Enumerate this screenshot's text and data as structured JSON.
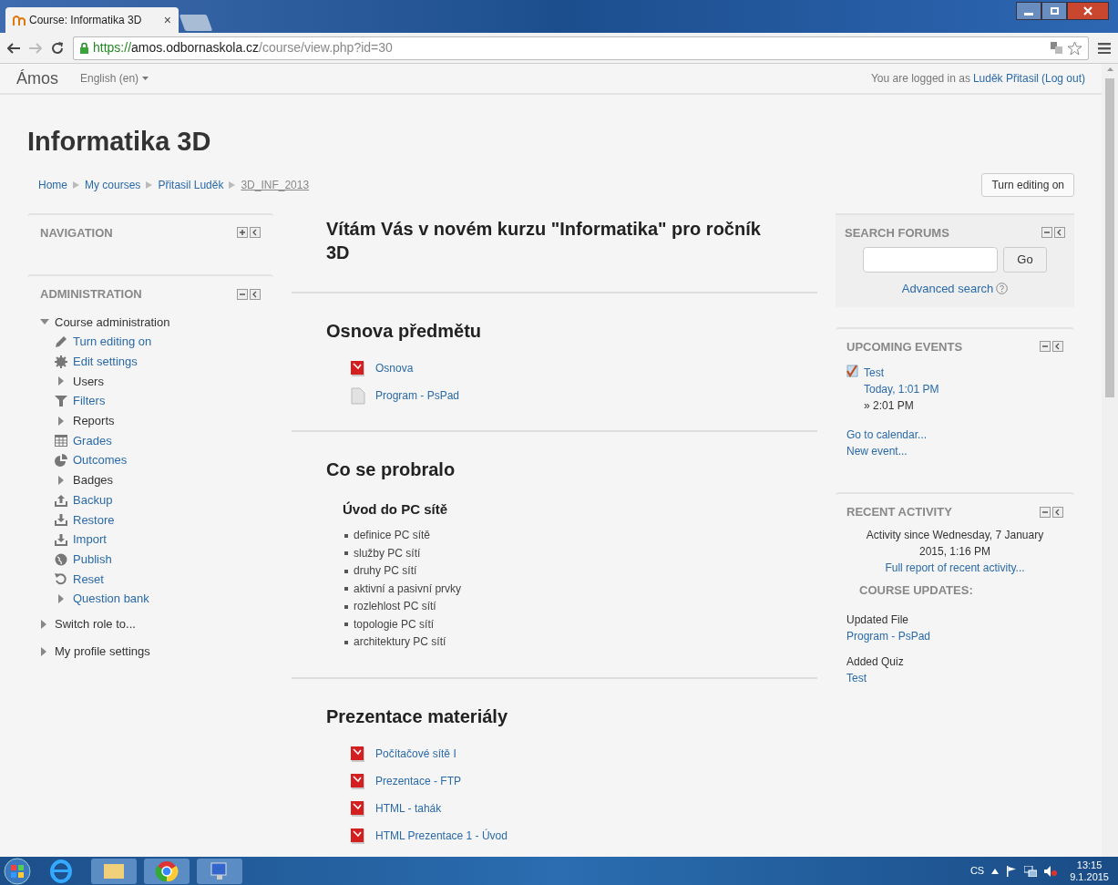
{
  "browser": {
    "tab_title": "Course: Informatika 3D",
    "tab_close": "×",
    "url_scheme": "https://",
    "url_host": "amos.odbornaskola.cz",
    "url_path": "/course/view.php?id=30"
  },
  "navbar": {
    "brand": "Ámos",
    "language": "English (en)",
    "login_prefix": "You are logged in as ",
    "user": "Luděk Přitasil",
    "logout": "(Log out)"
  },
  "page_title": "Informatika 3D",
  "breadcrumb": [
    "Home",
    "My courses",
    "Přitasil Luděk",
    "3D_INF_2013"
  ],
  "edit_button": "Turn editing on",
  "navigation_block": {
    "title": "NAVIGATION"
  },
  "administration": {
    "title": "ADMINISTRATION",
    "root": {
      "label": "Course administration",
      "expanded": true,
      "children": [
        {
          "label": "Turn editing on",
          "kind": "edit"
        },
        {
          "label": "Edit settings",
          "kind": "settings"
        },
        {
          "label": "Users",
          "kind": "branch"
        },
        {
          "label": "Filters",
          "kind": "filter"
        },
        {
          "label": "Reports",
          "kind": "branch"
        },
        {
          "label": "Grades",
          "kind": "grades"
        },
        {
          "label": "Outcomes",
          "kind": "outcomes"
        },
        {
          "label": "Badges",
          "kind": "branch"
        },
        {
          "label": "Backup",
          "kind": "backup"
        },
        {
          "label": "Restore",
          "kind": "restore"
        },
        {
          "label": "Import",
          "kind": "restore"
        },
        {
          "label": "Publish",
          "kind": "publish"
        },
        {
          "label": "Reset",
          "kind": "reset"
        },
        {
          "label": "Question bank",
          "kind": "branchlink"
        }
      ]
    },
    "others": [
      {
        "label": "Switch role to...",
        "expanded": false
      },
      {
        "label": "My profile settings",
        "expanded": false
      }
    ]
  },
  "welcome": "Vítám Vás v novém kurzu \"Informatika\" pro ročník 3D",
  "sections": [
    {
      "title": "Osnova předmětu",
      "resources": [
        {
          "label": "Osnova",
          "kind": "pdf"
        },
        {
          "label": "Program - PsPad",
          "kind": "file"
        }
      ]
    },
    {
      "title": "Co se probralo",
      "subtitle": "Úvod do PC sítě",
      "bullets": [
        "definice PC sítě",
        "služby PC sítí",
        "druhy PC sítí",
        "aktivní a pasivní prvky",
        "rozlehlost PC sítí",
        "topologie PC sítí",
        "architektury PC sítí"
      ]
    },
    {
      "title": "Prezentace materiály",
      "resources": [
        {
          "label": "Počítačové sítě I",
          "kind": "pdf"
        },
        {
          "label": "Prezentace - FTP",
          "kind": "pdf"
        },
        {
          "label": "HTML - tahák",
          "kind": "pdf"
        },
        {
          "label": "HTML Prezentace 1 - Úvod",
          "kind": "pdf"
        }
      ]
    }
  ],
  "search_forums": {
    "title": "SEARCH FORUMS",
    "go": "Go",
    "advanced": "Advanced search"
  },
  "upcoming_events": {
    "title": "UPCOMING EVENTS",
    "event": "Test",
    "when": "Today, 1:01 PM",
    "until": "» 2:01 PM",
    "links": [
      "Go to calendar...",
      "New event..."
    ]
  },
  "recent_activity": {
    "title": "RECENT ACTIVITY",
    "since": "Activity since Wednesday, 7 January 2015, 1:16 PM",
    "full_report": "Full report of recent activity...",
    "updates_title": "COURSE UPDATES:",
    "updates": [
      {
        "type": "Updated File",
        "link": "Program - PsPad"
      },
      {
        "type": "Added Quiz",
        "link": "Test"
      }
    ]
  },
  "taskbar": {
    "language": "CS",
    "time": "13:15",
    "date": "9.1.2015"
  }
}
